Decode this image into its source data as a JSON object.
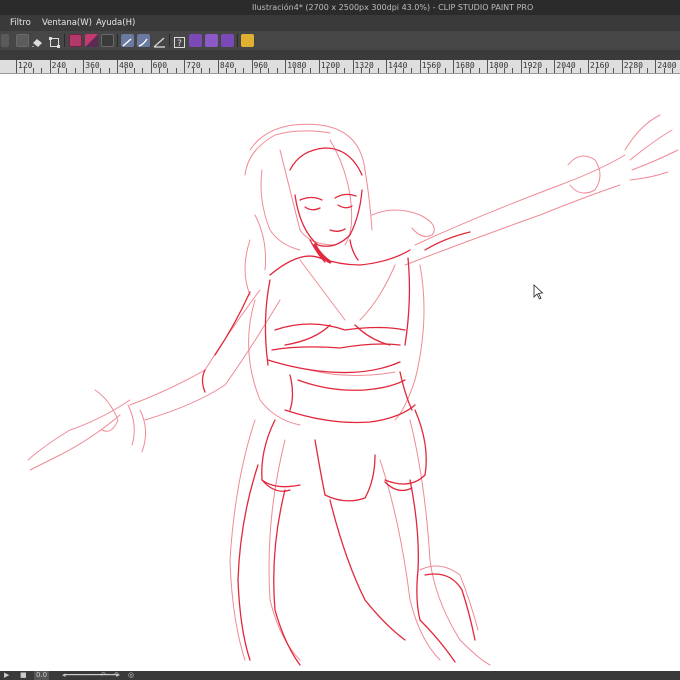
{
  "window": {
    "title": "Ilustración4* (2700 x 2500px 300dpi 43.0%)  -  CLIP STUDIO PAINT PRO"
  },
  "menu": {
    "items": [
      "Filtro",
      "Ventana(W)",
      "Ayuda(H)"
    ]
  },
  "ruler": {
    "labels": [
      "120",
      "240",
      "360",
      "480",
      "600",
      "720",
      "840",
      "960",
      "1080",
      "1200",
      "1320",
      "1440",
      "1560",
      "1680",
      "1800",
      "1920",
      "2040",
      "2160",
      "2280",
      "2400"
    ]
  },
  "statusbar": {
    "zoom_value": "0.0"
  },
  "colors": {
    "sketch": "#e2283c",
    "sketch_light": "#ef8a95"
  },
  "icons": [
    "pen-tool-icon",
    "fill-icon",
    "transform-icon",
    "color-swatch-icon",
    "stabilizer-icon",
    "ruler-icon",
    "help-icon",
    "layer-icon",
    "folder-icon",
    "material-icon",
    "settings-icon",
    "mouse-cursor-icon"
  ]
}
